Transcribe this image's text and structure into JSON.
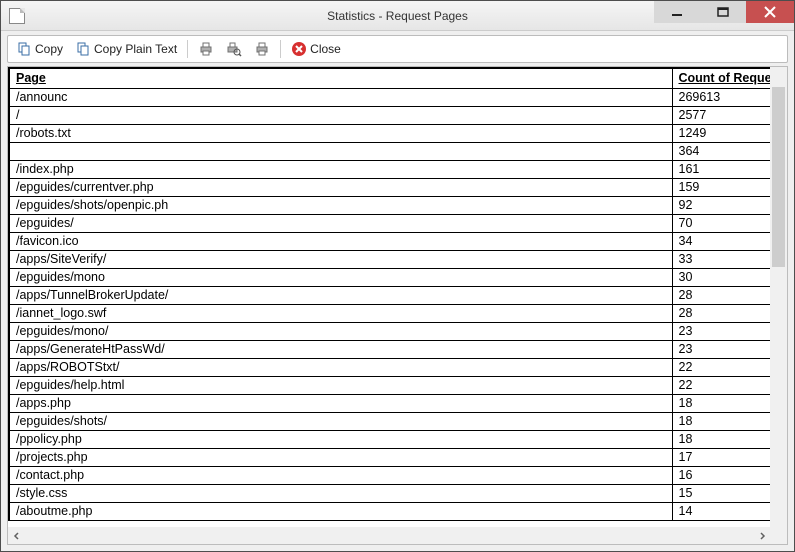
{
  "window": {
    "title": "Statistics - Request Pages"
  },
  "toolbar": {
    "copy_label": "Copy",
    "copy_plain_label": "Copy Plain Text",
    "close_label": "Close"
  },
  "table": {
    "headers": {
      "page": "Page",
      "count": "Count of Reques"
    },
    "rows": [
      {
        "page": "/announc",
        "count": "269613"
      },
      {
        "page": "/",
        "count": "2577"
      },
      {
        "page": "/robots.txt",
        "count": "1249"
      },
      {
        "page": "",
        "count": "364"
      },
      {
        "page": "/index.php",
        "count": "161"
      },
      {
        "page": "/epguides/currentver.php",
        "count": "159"
      },
      {
        "page": "/epguides/shots/openpic.ph",
        "count": "92"
      },
      {
        "page": "/epguides/",
        "count": "70"
      },
      {
        "page": "/favicon.ico",
        "count": "34"
      },
      {
        "page": "/apps/SiteVerify/",
        "count": "33"
      },
      {
        "page": "/epguides/mono",
        "count": "30"
      },
      {
        "page": "/apps/TunnelBrokerUpdate/",
        "count": "28"
      },
      {
        "page": "/iannet_logo.swf",
        "count": "28"
      },
      {
        "page": "/epguides/mono/",
        "count": "23"
      },
      {
        "page": "/apps/GenerateHtPassWd/",
        "count": "23"
      },
      {
        "page": "/apps/ROBOTStxt/",
        "count": "22"
      },
      {
        "page": "/epguides/help.html",
        "count": "22"
      },
      {
        "page": "/apps.php",
        "count": "18"
      },
      {
        "page": "/epguides/shots/",
        "count": "18"
      },
      {
        "page": "/ppolicy.php",
        "count": "18"
      },
      {
        "page": "/projects.php",
        "count": "17"
      },
      {
        "page": "/contact.php",
        "count": "16"
      },
      {
        "page": "/style.css",
        "count": "15"
      },
      {
        "page": "/aboutme.php",
        "count": "14"
      }
    ]
  }
}
